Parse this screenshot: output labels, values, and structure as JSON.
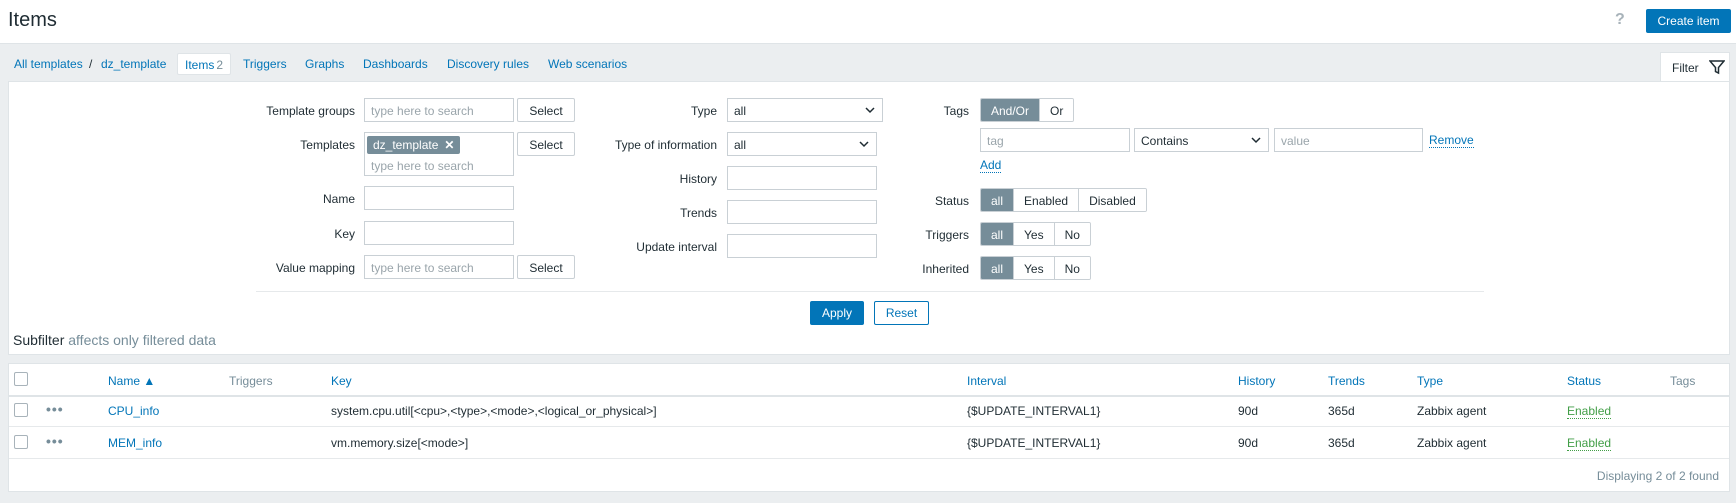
{
  "header": {
    "title": "Items",
    "help_icon": "?",
    "create_label": "Create item"
  },
  "nav": {
    "all_templates": "All templates",
    "separator": "/",
    "template": "dz_template",
    "items_label": "Items",
    "items_count": "2",
    "triggers": "Triggers",
    "graphs": "Graphs",
    "dashboards": "Dashboards",
    "discovery": "Discovery rules",
    "web": "Web scenarios",
    "filter_tab": "Filter"
  },
  "filter": {
    "template_groups_label": "Template groups",
    "templates_label": "Templates",
    "name_label": "Name",
    "key_label": "Key",
    "value_mapping_label": "Value mapping",
    "search_placeholder": "type here to search",
    "select_label": "Select",
    "template_chip": "dz_template",
    "type_label": "Type",
    "type_value": "all",
    "type_info_label": "Type of information",
    "type_info_value": "all",
    "history_label": "History",
    "trends_label": "Trends",
    "update_interval_label": "Update interval",
    "tags_label": "Tags",
    "tags_andor": "And/Or",
    "tags_or": "Or",
    "tag_placeholder": "tag",
    "tag_operator": "Contains",
    "value_placeholder": "value",
    "remove_label": "Remove",
    "add_label": "Add",
    "status_label": "Status",
    "status_all": "all",
    "status_enabled": "Enabled",
    "status_disabled": "Disabled",
    "triggers_label": "Triggers",
    "inherited_label": "Inherited",
    "opt_all": "all",
    "opt_yes": "Yes",
    "opt_no": "No",
    "apply_label": "Apply",
    "reset_label": "Reset"
  },
  "subfilter": {
    "title": "Subfilter",
    "note": "affects only filtered data"
  },
  "table": {
    "columns": {
      "name": "Name ▲",
      "triggers": "Triggers",
      "key": "Key",
      "interval": "Interval",
      "history": "History",
      "trends": "Trends",
      "type": "Type",
      "status": "Status",
      "tags": "Tags"
    },
    "rows": [
      {
        "name": "CPU_info",
        "key": "system.cpu.util[<cpu>,<type>,<mode>,<logical_or_physical>]",
        "interval": "{$UPDATE_INTERVAL1}",
        "history": "90d",
        "trends": "365d",
        "type": "Zabbix agent",
        "status": "Enabled"
      },
      {
        "name": "MEM_info",
        "key": "vm.memory.size[<mode>]",
        "interval": "{$UPDATE_INTERVAL1}",
        "history": "90d",
        "trends": "365d",
        "type": "Zabbix agent",
        "status": "Enabled"
      }
    ],
    "footer": "Displaying 2 of 2 found"
  }
}
